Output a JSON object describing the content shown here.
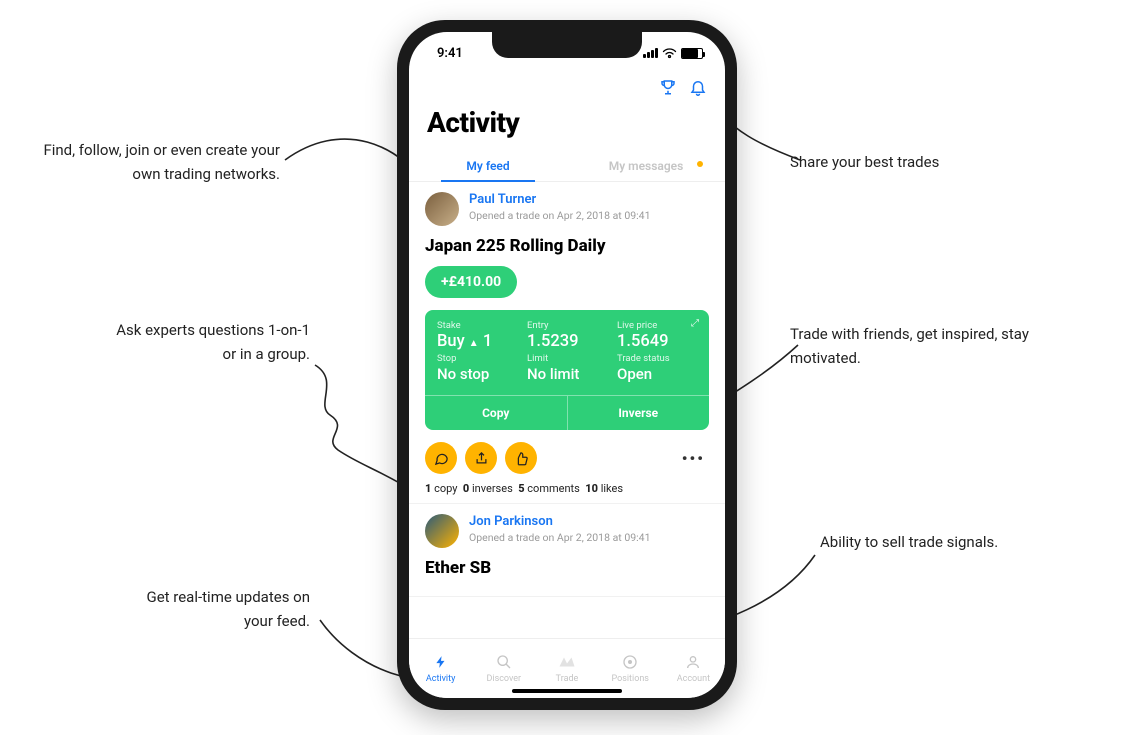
{
  "status": {
    "time": "9:41"
  },
  "header": {
    "title": "Activity"
  },
  "tabs": {
    "feed": "My feed",
    "messages": "My messages"
  },
  "posts": [
    {
      "name": "Paul Turner",
      "meta": "Opened a trade on Apr 2, 2018 at 09:41",
      "instrument": "Japan 225 Rolling Daily",
      "pnl": "+£410.00",
      "stake_label": "Stake",
      "stake_value": "Buy",
      "stake_qty": "1",
      "entry_label": "Entry",
      "entry_value": "1.5239",
      "live_label": "Live price",
      "live_value": "1.5649",
      "stop_label": "Stop",
      "stop_value": "No stop",
      "limit_label": "Limit",
      "limit_value": "No limit",
      "status_label": "Trade status",
      "status_value": "Open",
      "copy": "Copy",
      "inverse": "Inverse",
      "stats": {
        "copies": "1",
        "copies_l": "copy",
        "inverses": "0",
        "inverses_l": "inverses",
        "comments": "5",
        "comments_l": "comments",
        "likes": "10",
        "likes_l": "likes"
      }
    },
    {
      "name": "Jon Parkinson",
      "meta": "Opened a trade on Apr 2, 2018 at 09:41",
      "instrument": "Ether SB"
    }
  ],
  "tabbar": {
    "activity": "Activity",
    "discover": "Discover",
    "trade": "Trade",
    "positions": "Positions",
    "account": "Account"
  },
  "annotations": {
    "a1": "Find, follow, join or even create your own trading networks.",
    "a2": "Ask experts questions 1-on-1 or in a group.",
    "a3": "Get real-time updates on your feed.",
    "a4": "Share your best trades",
    "a5": "Trade with friends, get inspired, stay motivated.",
    "a6": "Ability to sell trade signals."
  }
}
